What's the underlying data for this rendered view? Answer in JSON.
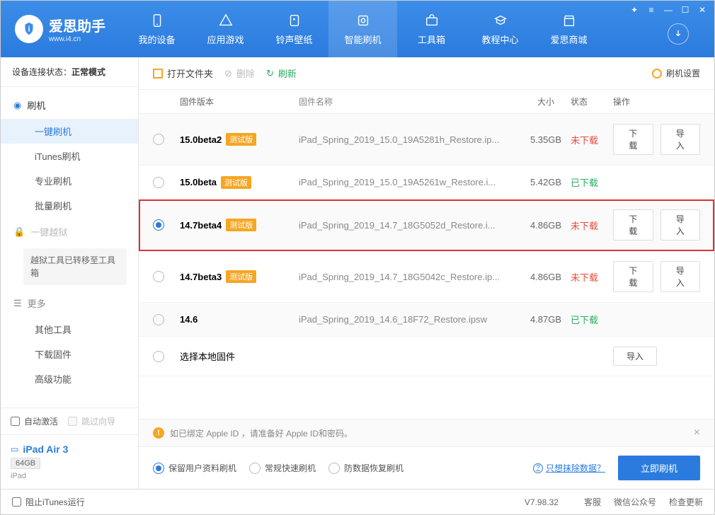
{
  "brand": {
    "name": "爱思助手",
    "domain": "www.i4.cn",
    "logo_letter": "i"
  },
  "window_controls": [
    "✦",
    "≡",
    "—",
    "☐",
    "✕"
  ],
  "nav": [
    {
      "label": "我的设备",
      "icon": "device"
    },
    {
      "label": "应用游戏",
      "icon": "appstore"
    },
    {
      "label": "铃声壁纸",
      "icon": "ringtone"
    },
    {
      "label": "智能刷机",
      "icon": "flash",
      "active": true
    },
    {
      "label": "工具箱",
      "icon": "toolbox"
    },
    {
      "label": "教程中心",
      "icon": "tutorial"
    },
    {
      "label": "爱思商城",
      "icon": "shop"
    }
  ],
  "sidebar": {
    "conn_label": "设备连接状态：",
    "conn_value": "正常模式",
    "sections": {
      "flash_head": "刷机",
      "items": [
        "一键刷机",
        "iTunes刷机",
        "专业刷机",
        "批量刷机"
      ],
      "jailbreak_head": "一键越狱",
      "jailbreak_note": "越狱工具已转移至工具箱",
      "more_head": "更多",
      "more_items": [
        "其他工具",
        "下载固件",
        "高级功能"
      ]
    },
    "auto_activate": "自动激活",
    "skip_guide": "跳过向导",
    "device": {
      "name": "iPad Air 3",
      "storage": "64GB",
      "model": "iPad"
    }
  },
  "toolbar": {
    "open_folder": "打开文件夹",
    "delete": "删除",
    "refresh": "刷新",
    "settings": "刷机设置"
  },
  "table": {
    "headers": {
      "version": "固件版本",
      "name": "固件名称",
      "size": "大小",
      "status": "状态",
      "actions": "操作"
    },
    "download": "下载",
    "import": "导入",
    "local_row": "选择本地固件",
    "status_not": "未下载",
    "status_done": "已下载",
    "rows": [
      {
        "version": "15.0beta2",
        "beta": true,
        "badge": "测试版",
        "name": "iPad_Spring_2019_15.0_19A5281h_Restore.ip...",
        "size": "5.35GB",
        "status": "not",
        "selected": false
      },
      {
        "version": "15.0beta",
        "beta": true,
        "badge": "测试版",
        "name": "iPad_Spring_2019_15.0_19A5261w_Restore.i...",
        "size": "5.42GB",
        "status": "done",
        "selected": false
      },
      {
        "version": "14.7beta4",
        "beta": true,
        "badge": "测试版",
        "name": "iPad_Spring_2019_14.7_18G5052d_Restore.i...",
        "size": "4.86GB",
        "status": "not",
        "selected": true,
        "highlight": true
      },
      {
        "version": "14.7beta3",
        "beta": true,
        "badge": "测试版",
        "name": "iPad_Spring_2019_14.7_18G5042c_Restore.ip...",
        "size": "4.86GB",
        "status": "not",
        "selected": false
      },
      {
        "version": "14.6",
        "beta": false,
        "name": "iPad_Spring_2019_14.6_18F72_Restore.ipsw",
        "size": "4.87GB",
        "status": "done",
        "selected": false
      }
    ]
  },
  "notice": "如已绑定 Apple ID ，请准备好 Apple ID和密码。",
  "options": {
    "keep_data": "保留用户资料刷机",
    "normal_fast": "常规快速刷机",
    "anti_recovery": "防数据恢复刷机",
    "wipe_help": "只想抹除数据？",
    "flash_now": "立即刷机"
  },
  "statusbar": {
    "block_itunes": "阻止iTunes运行",
    "version": "V7.98.32",
    "items": [
      "客服",
      "微信公众号",
      "检查更新"
    ]
  }
}
